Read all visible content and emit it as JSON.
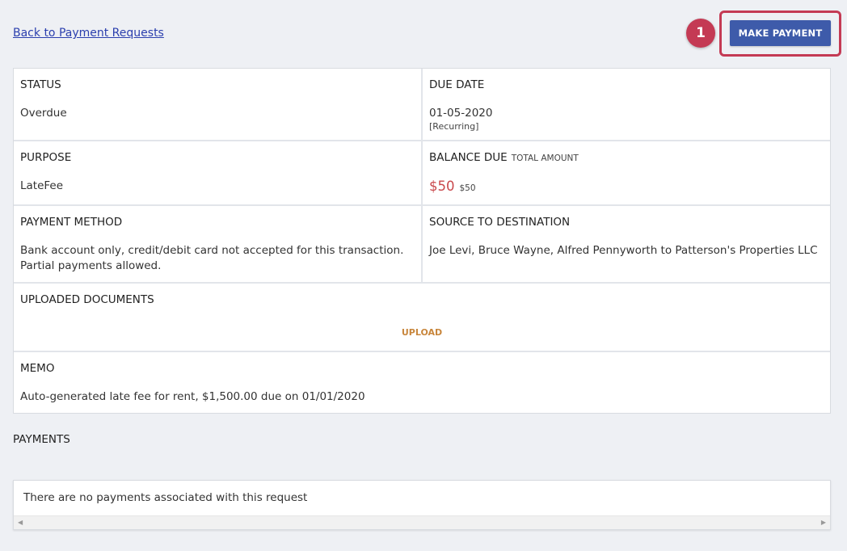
{
  "header": {
    "back_link": "Back to Payment Requests",
    "callout_number": "1",
    "make_payment_label": "MAKE PAYMENT"
  },
  "details": {
    "status": {
      "label": "STATUS",
      "value": "Overdue"
    },
    "due_date": {
      "label": "DUE DATE",
      "value": "01-05-2020",
      "note": "[Recurring]"
    },
    "purpose": {
      "label": "PURPOSE",
      "value": "LateFee"
    },
    "balance": {
      "label": "BALANCE DUE",
      "sub_label": "TOTAL AMOUNT",
      "value": "$50",
      "total": "$50"
    },
    "payment_method": {
      "label": "PAYMENT METHOD",
      "value": "Bank account only, credit/debit card not accepted for this transaction. Partial payments allowed."
    },
    "source": {
      "label": "SOURCE TO DESTINATION",
      "value": "Joe Levi, Bruce Wayne, Alfred Pennyworth to Patterson's Properties LLC"
    },
    "documents": {
      "label": "UPLOADED DOCUMENTS",
      "upload_label": "UPLOAD"
    },
    "memo": {
      "label": "MEMO",
      "value": "Auto-generated late fee for rent, $1,500.00 due on 01/01/2020"
    }
  },
  "payments": {
    "title": "PAYMENTS",
    "empty_message": "There are no payments associated with this request"
  },
  "colors": {
    "primary_button": "#3e5baa",
    "callout": "#c43a54",
    "balance": "#c9484c",
    "upload": "#c8863c",
    "link": "#2b3fae"
  }
}
